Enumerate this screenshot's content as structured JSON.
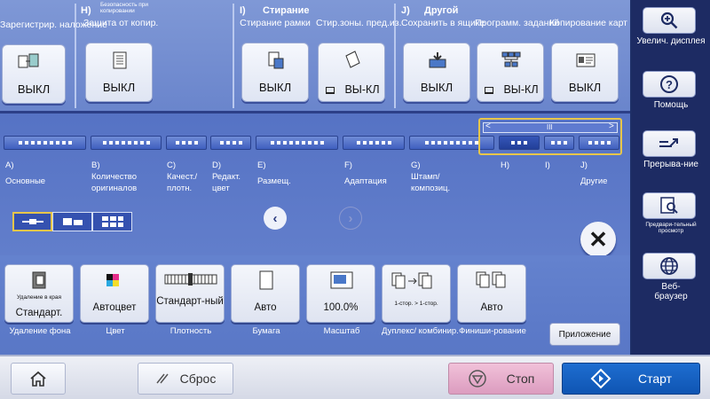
{
  "colors": {
    "accent_blue": "#4a66b8",
    "highlight": "#e7c64a",
    "start": "#1e6dd0",
    "stop": "#e7a9cb",
    "sidebar": "#1d2b63"
  },
  "top": {
    "group_h": {
      "code": "H)",
      "small_title": "Безопасность при копировании"
    },
    "group_i": {
      "code": "I)",
      "title": "Стирание"
    },
    "group_j": {
      "code": "J)",
      "title": "Другой"
    },
    "functions": [
      {
        "label": "Зарегистрир. наложение",
        "value": "ВЫКЛ"
      },
      {
        "label": "Защита от копир.",
        "value": "ВЫКЛ"
      },
      {
        "label": "Стирание рамки",
        "value": "ВЫКЛ"
      },
      {
        "label": "Стир.зоны. пред.из.",
        "value": "ВЫ-КЛ"
      },
      {
        "label": "Сохранить в ящике",
        "value": "ВЫКЛ"
      },
      {
        "label": "Программ. заданий",
        "value": "ВЫ-КЛ"
      },
      {
        "label": "Копирование карт",
        "value": "ВЫКЛ"
      }
    ]
  },
  "tabs": [
    {
      "code": "A)",
      "label": "Основные"
    },
    {
      "code": "B)",
      "label": "Количество оригиналов"
    },
    {
      "code": "C)",
      "label": "Качест./ плотн."
    },
    {
      "code": "D)",
      "label": "Редакт. цвет"
    },
    {
      "code": "E)",
      "label": "Размещ."
    },
    {
      "code": "F)",
      "label": "Адаптация"
    },
    {
      "code": "G)",
      "label": "Штамп/ композиц."
    },
    {
      "code": "H)",
      "label": ""
    },
    {
      "code": "I)",
      "label": ""
    },
    {
      "code": "J)",
      "label": "Другие"
    }
  ],
  "scroll": {
    "left_arrow": "<",
    "right_arrow": ">",
    "thumb": "III"
  },
  "quick": [
    {
      "label": "Удаление фона",
      "top_text": "Удаление в края",
      "value": "Стандарт."
    },
    {
      "label": "Цвет",
      "value": "Автоцвет"
    },
    {
      "label": "Плотность",
      "value": "Стандарт-ный"
    },
    {
      "label": "Бумага",
      "value": "Авто"
    },
    {
      "label": "Масштаб",
      "value": "100.0%"
    },
    {
      "label": "Дуплекс/ комбинир.",
      "value": "1-стор. > 1-стор."
    },
    {
      "label": "Финиши-рование",
      "value": "Авто"
    }
  ],
  "app_button": "Приложение",
  "sidebar": [
    {
      "label": "Увелич. дисплея",
      "icon": "zoom-in-icon"
    },
    {
      "label": "Помощь",
      "icon": "help-icon"
    },
    {
      "label": "Прерыва-ние",
      "icon": "interrupt-icon"
    },
    {
      "label": "Предвари-тельный просмотр",
      "icon": "preview-icon"
    },
    {
      "label": "Веб-браузер",
      "icon": "globe-icon"
    }
  ],
  "footer": {
    "reset": "Сброс",
    "stop": "Стоп",
    "start": "Старт"
  }
}
